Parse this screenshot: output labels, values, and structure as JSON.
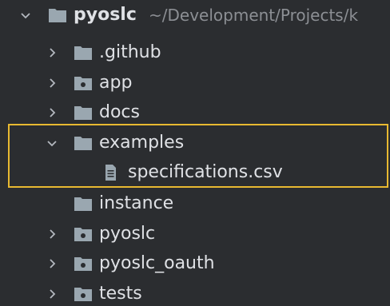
{
  "project_tree": {
    "root": {
      "name": "pyoslc",
      "path": "~/Development/Projects/k",
      "expanded": true,
      "icon": "folder-icon"
    },
    "items": [
      {
        "label": ".github",
        "type": "folder",
        "expanded": false,
        "icon": "folder-icon"
      },
      {
        "label": "app",
        "type": "package",
        "expanded": false,
        "icon": "package-folder-icon"
      },
      {
        "label": "docs",
        "type": "folder",
        "expanded": false,
        "icon": "folder-icon"
      },
      {
        "label": "examples",
        "type": "folder",
        "expanded": true,
        "icon": "folder-icon"
      },
      {
        "label": "specifications.csv",
        "type": "file",
        "icon": "text-file-icon"
      },
      {
        "label": "instance",
        "type": "folder",
        "expandable": false,
        "icon": "folder-icon"
      },
      {
        "label": "pyoslc",
        "type": "package",
        "expanded": false,
        "icon": "package-folder-icon"
      },
      {
        "label": "pyoslc_oauth",
        "type": "package",
        "expanded": false,
        "icon": "package-folder-icon"
      },
      {
        "label": "tests",
        "type": "package",
        "expanded": false,
        "icon": "package-folder-icon"
      }
    ]
  },
  "colors": {
    "background": "#2b2d30",
    "text": "#dfe1e5",
    "path_text": "#8c8f94",
    "folder": "#9aa7b0",
    "highlight_border": "#e8b931"
  }
}
